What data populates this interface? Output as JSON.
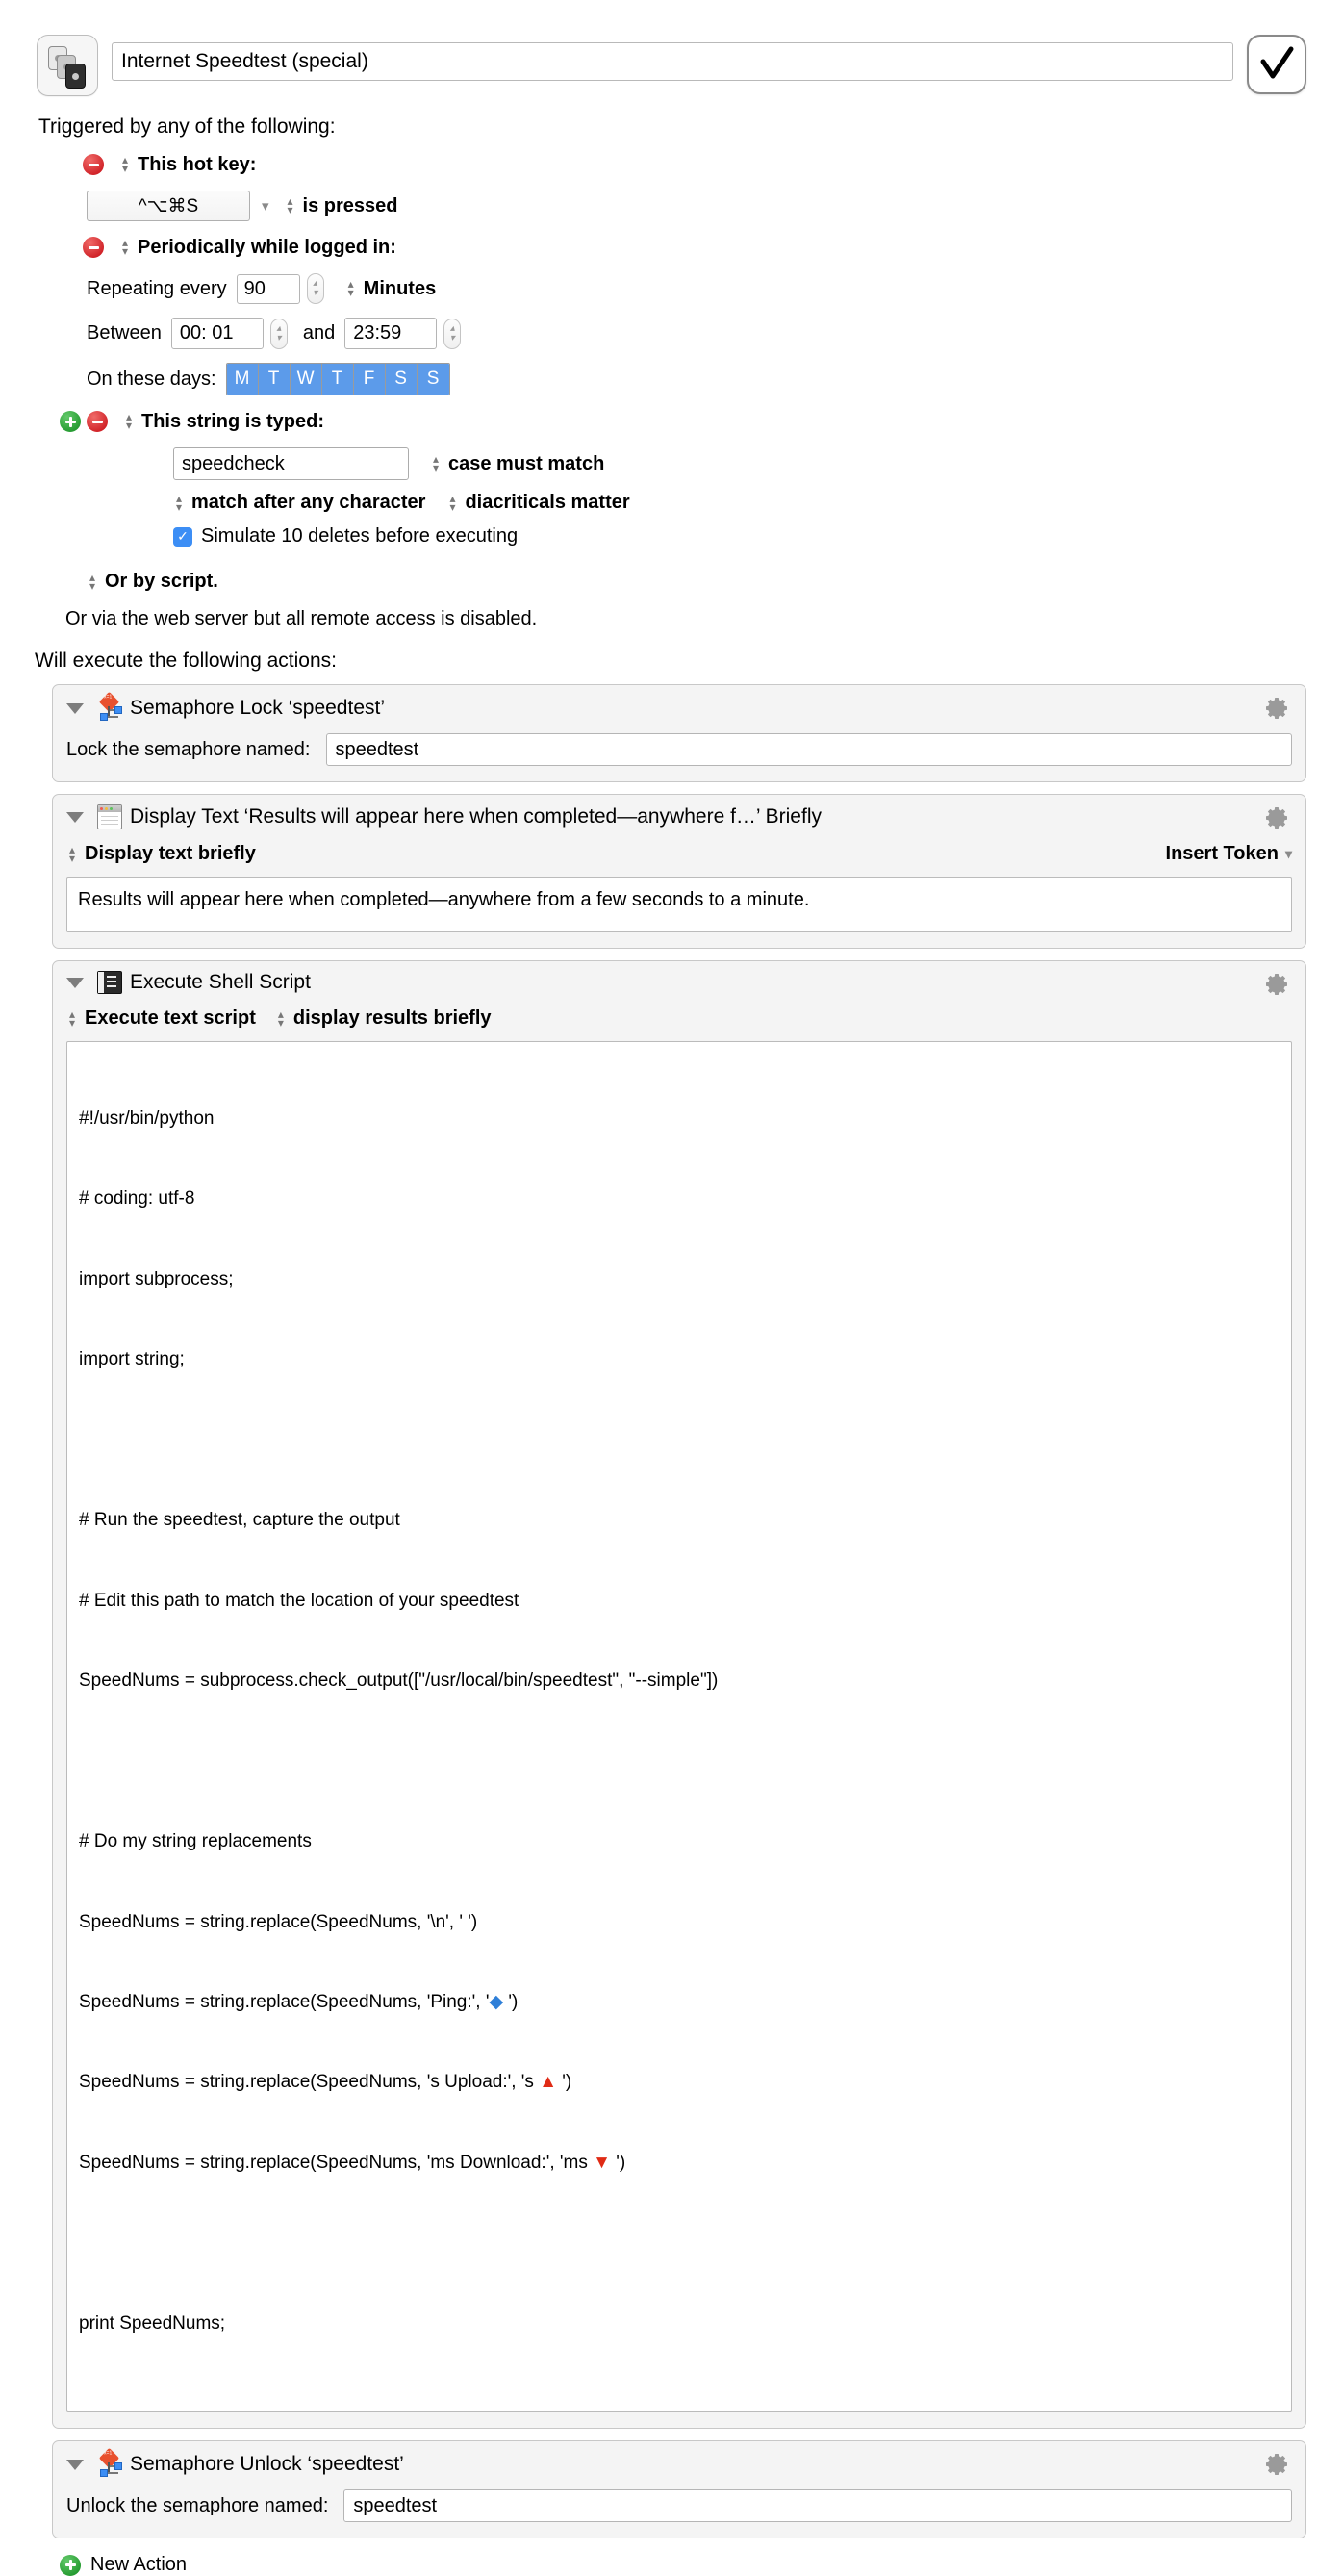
{
  "header": {
    "macro_icon": "macro-stack-icon",
    "title_value": "Internet Speedtest (special)",
    "enabled_checkmark": "check-icon"
  },
  "triggers": {
    "section_label": "Triggered by any of the following:",
    "hotkey": {
      "remove_label": "minus-icon",
      "label": "This hot key:",
      "key_value": "^⌥⌘S",
      "condition": "is pressed"
    },
    "periodic": {
      "remove_label": "minus-icon",
      "label": "Periodically while logged in:",
      "repeating_label": "Repeating every",
      "repeating_value": "90",
      "unit": "Minutes",
      "between_label": "Between",
      "from_value": "00: 01",
      "and_label": "and",
      "to_value": "23:59",
      "days_label": "On these days:",
      "days": [
        "M",
        "T",
        "W",
        "T",
        "F",
        "S",
        "S"
      ]
    },
    "typed_string": {
      "add_label": "plus-icon",
      "remove_label": "minus-icon",
      "label": "This string is typed:",
      "string_value": "speedcheck",
      "case_option": "case must match",
      "match_option": "match after any character",
      "diacriticals_option": "diacriticals matter",
      "simulate_deletes_checked": true,
      "simulate_deletes_label": "Simulate 10 deletes before executing"
    },
    "by_script": "Or by script.",
    "web_server_note": "Or via the web server but all remote access is disabled."
  },
  "actions_section_label": "Will execute the following actions:",
  "actions": [
    {
      "icon": "semaphore-icon",
      "title": "Semaphore Lock ‘speedtest’",
      "field_label": "Lock the semaphore named:",
      "field_value": "speedtest"
    },
    {
      "icon": "window-icon",
      "title": "Display Text ‘Results will appear here when completed—anywhere f…’ Briefly",
      "option": "Display text briefly",
      "insert_token": "Insert Token",
      "body": "Results will appear here when completed—anywhere from a few seconds to a minute."
    },
    {
      "icon": "terminal-icon",
      "title": "Execute Shell Script",
      "option1": "Execute text script",
      "option2": "display results briefly",
      "script_lines": [
        "#!/usr/bin/python",
        "# coding: utf-8",
        "import subprocess;",
        "import string;",
        "",
        "# Run the speedtest, capture the output",
        "# Edit this path to match the location of your speedtest",
        "SpeedNums = subprocess.check_output([\"/usr/local/bin/speedtest\", \"--simple\"])",
        "",
        "# Do my string replacements",
        "SpeedNums = string.replace(SpeedNums, '\\n', ' ')",
        "SpeedNums = string.replace(SpeedNums, 'Ping:', '◆ ')",
        "SpeedNums = string.replace(SpeedNums, 's Upload:', 's ▲ ')",
        "SpeedNums = string.replace(SpeedNums, 'ms Download:', 'ms ▼ ')",
        "",
        "print SpeedNums;"
      ]
    },
    {
      "icon": "semaphore-icon",
      "title": "Semaphore Unlock ‘speedtest’",
      "field_label": "Unlock the semaphore named:",
      "field_value": "speedtest"
    }
  ],
  "new_action": {
    "icon": "plus-icon",
    "label": "New Action"
  },
  "colors": {
    "accent_blue": "#5c9bea",
    "remove_red": "#cf1f25",
    "add_green": "#23992f",
    "card_bg": "#f4f4f4"
  }
}
